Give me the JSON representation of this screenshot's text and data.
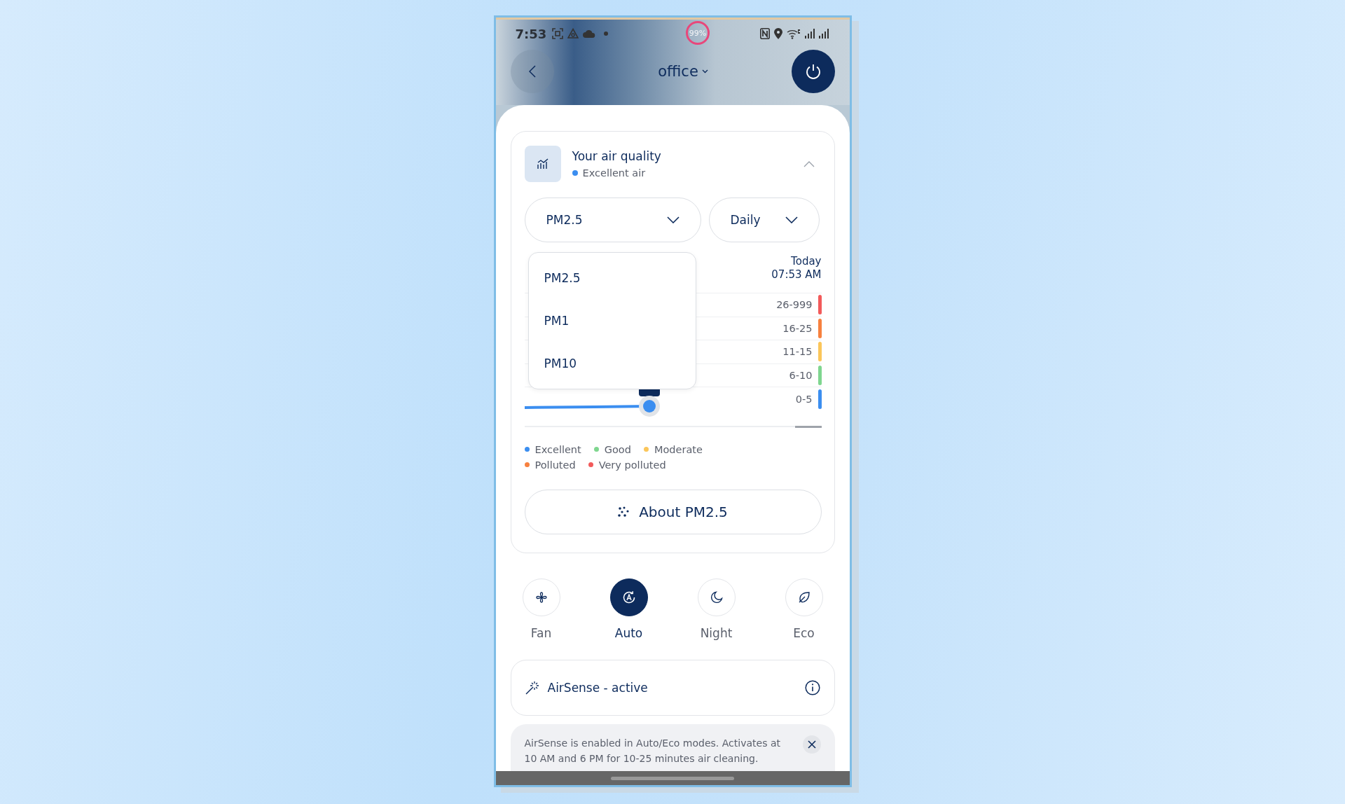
{
  "status_bar": {
    "time": "7:53",
    "battery": "99%"
  },
  "header": {
    "title": "office"
  },
  "air_quality": {
    "title": "Your air quality",
    "expanded": true,
    "status": {
      "label": "Excellent air",
      "color": "#3b8ef0"
    },
    "pollutant_select": {
      "value": "PM2.5",
      "open": true,
      "options": [
        {
          "label": "PM2.5"
        },
        {
          "label": "PM1"
        },
        {
          "label": "PM10"
        }
      ]
    },
    "period_select": {
      "value": "Daily"
    },
    "chart": {
      "time_label": "Today",
      "time": "07:53 AM",
      "ranges": [
        {
          "label": "26-999",
          "color": "#f25a5a"
        },
        {
          "label": "16-25",
          "color": "#f7813f"
        },
        {
          "label": "11-15",
          "color": "#fbc65a"
        },
        {
          "label": "6-10",
          "color": "#7fd68f"
        },
        {
          "label": "0-5",
          "color": "#3b8ef0"
        }
      ]
    },
    "legend": [
      {
        "label": "Excellent",
        "color": "#3b8ef0"
      },
      {
        "label": "Good",
        "color": "#7fd68f"
      },
      {
        "label": "Moderate",
        "color": "#fbc65a"
      },
      {
        "label": "Polluted",
        "color": "#f7813f"
      },
      {
        "label": "Very polluted",
        "color": "#f25a5a"
      }
    ],
    "about_button": "About PM2.5"
  },
  "modes": [
    {
      "label": "Fan",
      "kind": "fan",
      "selected": false
    },
    {
      "label": "Auto",
      "kind": "auto",
      "selected": true
    },
    {
      "label": "Night",
      "kind": "night",
      "selected": false
    },
    {
      "label": "Eco",
      "kind": "eco",
      "selected": false
    }
  ],
  "airsense": {
    "label": "AirSense - active"
  },
  "notice": {
    "text": "AirSense is enabled in Auto/Eco modes. Activates at 10 AM and 6 PM for 10-25 minutes air cleaning."
  }
}
